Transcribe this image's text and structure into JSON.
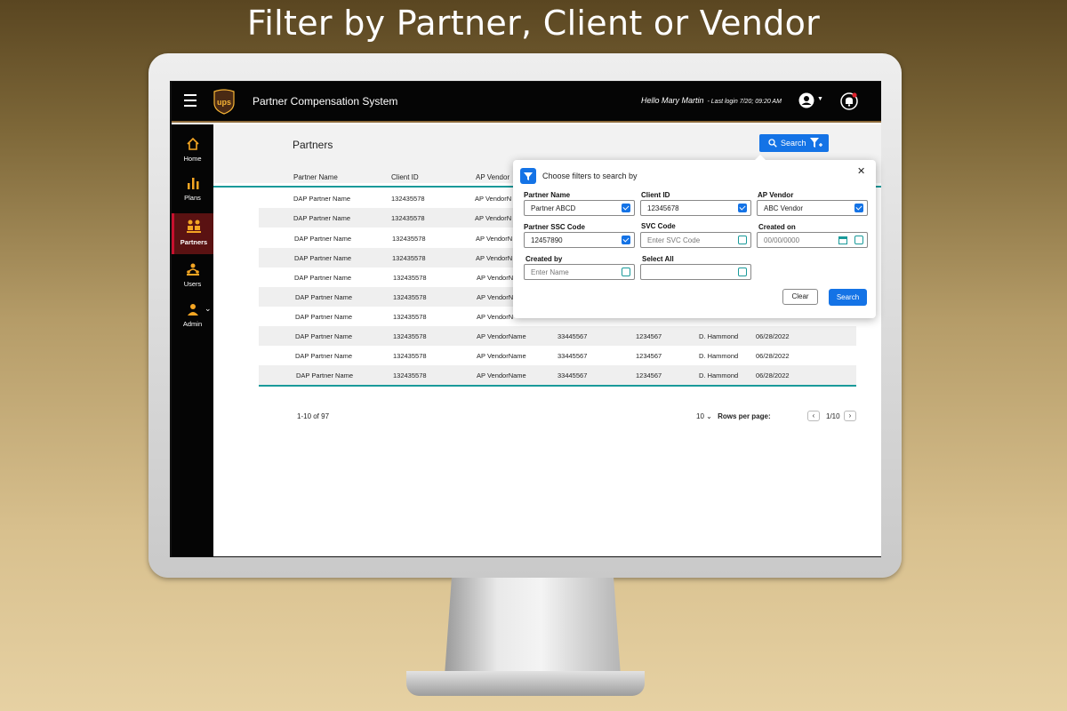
{
  "headline": "Filter by Partner, Client or Vendor",
  "app": {
    "title": "Partner Compensation System",
    "greeting": "Hello Mary Martin",
    "last_login": "- Last login 7/20; 09:20 AM"
  },
  "sidebar": {
    "items": [
      {
        "label": "Home",
        "icon": "home-icon"
      },
      {
        "label": "Plans",
        "icon": "bar-chart-icon"
      },
      {
        "label": "Partners",
        "icon": "partners-icon",
        "active": true
      },
      {
        "label": "Users",
        "icon": "users-icon"
      },
      {
        "label": "Admin",
        "icon": "admin-icon"
      }
    ]
  },
  "page": {
    "title": "Partners",
    "search_label": "Search"
  },
  "table": {
    "columns": [
      "Partner Name",
      "Client ID",
      "AP Vendor"
    ],
    "rows": [
      {
        "partner": "DAP Partner Name",
        "client": "132435578",
        "vendor": "AP VendorN",
        "ssc": "",
        "code": "",
        "by": "",
        "date": ""
      },
      {
        "partner": "DAP Partner Name",
        "client": "132435578",
        "vendor": "AP VendorN",
        "ssc": "",
        "code": "",
        "by": "",
        "date": ""
      },
      {
        "partner": "DAP Partner Name",
        "client": "132435578",
        "vendor": "AP VendorN",
        "ssc": "",
        "code": "",
        "by": "",
        "date": ""
      },
      {
        "partner": "DAP Partner Name",
        "client": "132435578",
        "vendor": "AP VendorN",
        "ssc": "",
        "code": "",
        "by": "",
        "date": ""
      },
      {
        "partner": "DAP Partner Name",
        "client": "132435578",
        "vendor": "AP VendorN",
        "ssc": "",
        "code": "",
        "by": "",
        "date": ""
      },
      {
        "partner": "DAP Partner Name",
        "client": "132435578",
        "vendor": "AP VendorN",
        "ssc": "",
        "code": "",
        "by": "",
        "date": ""
      },
      {
        "partner": "DAP Partner Name",
        "client": "132435578",
        "vendor": "AP VendorN",
        "ssc": "",
        "code": "",
        "by": "",
        "date": ""
      },
      {
        "partner": "DAP Partner Name",
        "client": "132435578",
        "vendor": "AP VendorName",
        "ssc": "33445567",
        "code": "1234567",
        "by": "D. Hammond",
        "date": "06/28/2022"
      },
      {
        "partner": "DAP Partner Name",
        "client": "132435578",
        "vendor": "AP VendorName",
        "ssc": "33445567",
        "code": "1234567",
        "by": "D. Hammond",
        "date": "06/28/2022"
      },
      {
        "partner": "DAP Partner Name",
        "client": "132435578",
        "vendor": "AP VendorName",
        "ssc": "33445567",
        "code": "1234567",
        "by": "D. Hammond",
        "date": "06/28/2022"
      }
    ]
  },
  "pagination": {
    "range": "1-10 of 97",
    "rows_value": "10 ⌄",
    "rows_label": "Rows per page:",
    "page": "1/10"
  },
  "filter": {
    "title": "Choose filters to search by",
    "fields": [
      {
        "label": "Partner Name",
        "value": "Partner ABCD",
        "checked": true
      },
      {
        "label": "Client ID",
        "value": "12345678",
        "checked": true
      },
      {
        "label": "AP Vendor",
        "value": "ABC Vendor",
        "checked": true
      },
      {
        "label": "Partner SSC Code",
        "value": "12457890",
        "checked": true
      },
      {
        "label": "SVC Code",
        "placeholder": "Enter SVC Code",
        "checked": false
      },
      {
        "label": "Created on",
        "placeholder": "00/00/0000",
        "checked": false
      },
      {
        "label": "Created by",
        "placeholder": "Enter Name",
        "checked": false
      },
      {
        "label": "Select All",
        "value": "",
        "checked": false
      }
    ],
    "clear_label": "Clear",
    "search_label": "Search"
  },
  "colors": {
    "accent": "#1473e6",
    "teal": "#1a9a9a",
    "brand_brown": "#8c6a3a"
  }
}
